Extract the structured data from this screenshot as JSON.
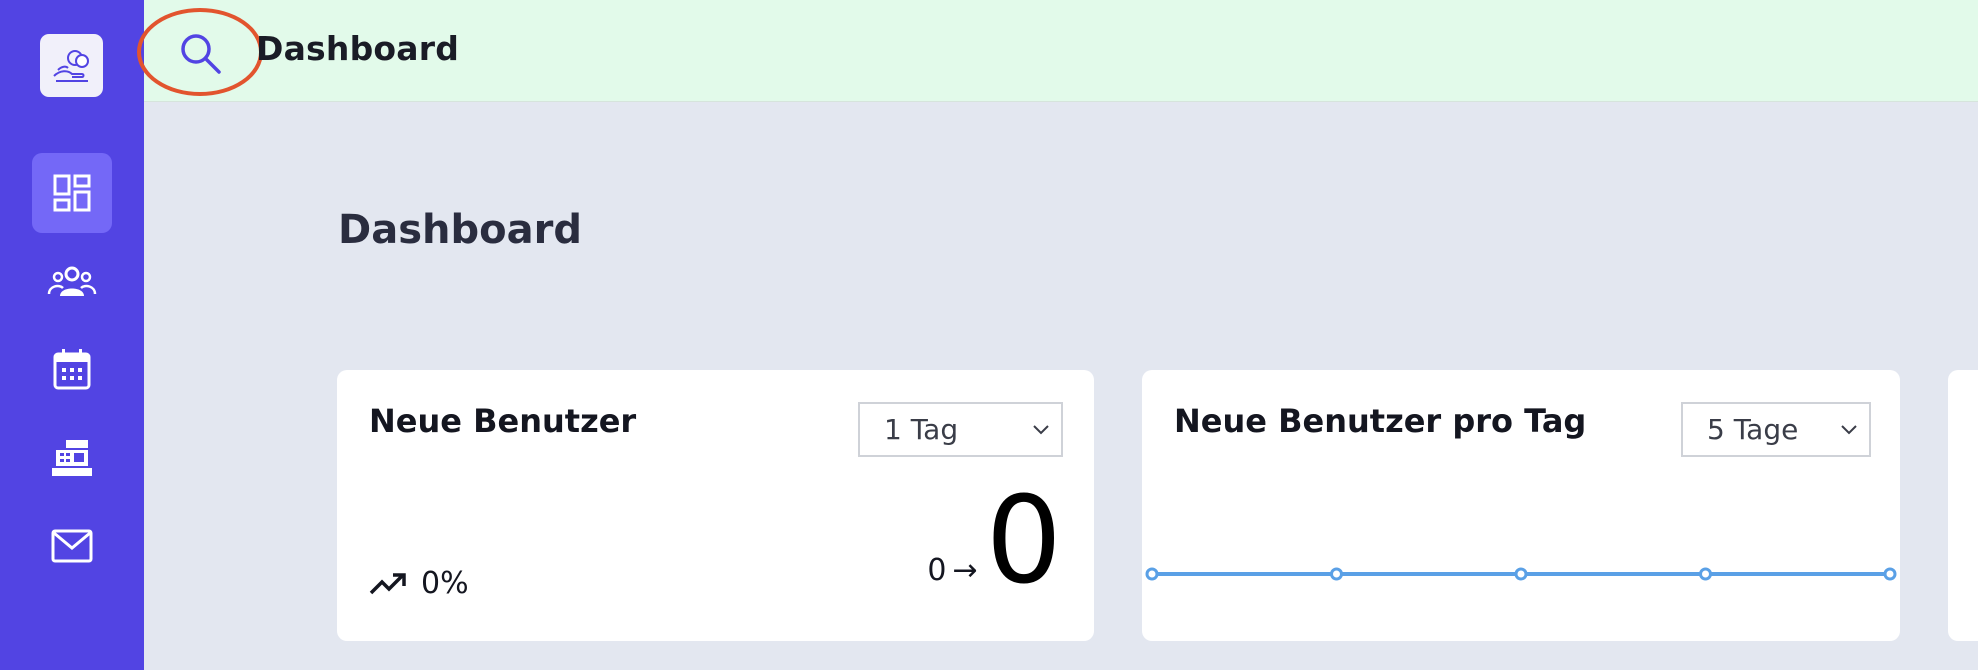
{
  "topbar": {
    "title": "Dashboard",
    "search_icon": "search-icon"
  },
  "sidebar": {
    "logo_icon": "coins-hand-icon",
    "items": [
      {
        "icon": "dashboard-icon",
        "active": true
      },
      {
        "icon": "users-icon",
        "active": false
      },
      {
        "icon": "calendar-icon",
        "active": false
      },
      {
        "icon": "cash-register-icon",
        "active": false
      },
      {
        "icon": "mail-icon",
        "active": false
      }
    ]
  },
  "main": {
    "title": "Dashboard",
    "cards": [
      {
        "title": "Neue Benutzer",
        "select_value": "1 Tag",
        "trend_value": "0%",
        "stat_prev": "0",
        "stat_arrow": "→",
        "stat_current": "0"
      },
      {
        "title": "Neue Benutzer pro Tag",
        "select_value": "5 Tage"
      }
    ]
  },
  "chart_data": {
    "type": "line",
    "x": [
      1,
      2,
      3,
      4,
      5
    ],
    "series": [
      {
        "values": [
          0,
          0,
          0,
          0,
          0
        ]
      }
    ],
    "color": "#5aa0e6"
  },
  "colors": {
    "sidebar": "#5244e3",
    "sidebar_active": "#7468f7",
    "topbar": "#e2faea",
    "background": "#e3e7f0",
    "highlight": "#e2542e"
  }
}
